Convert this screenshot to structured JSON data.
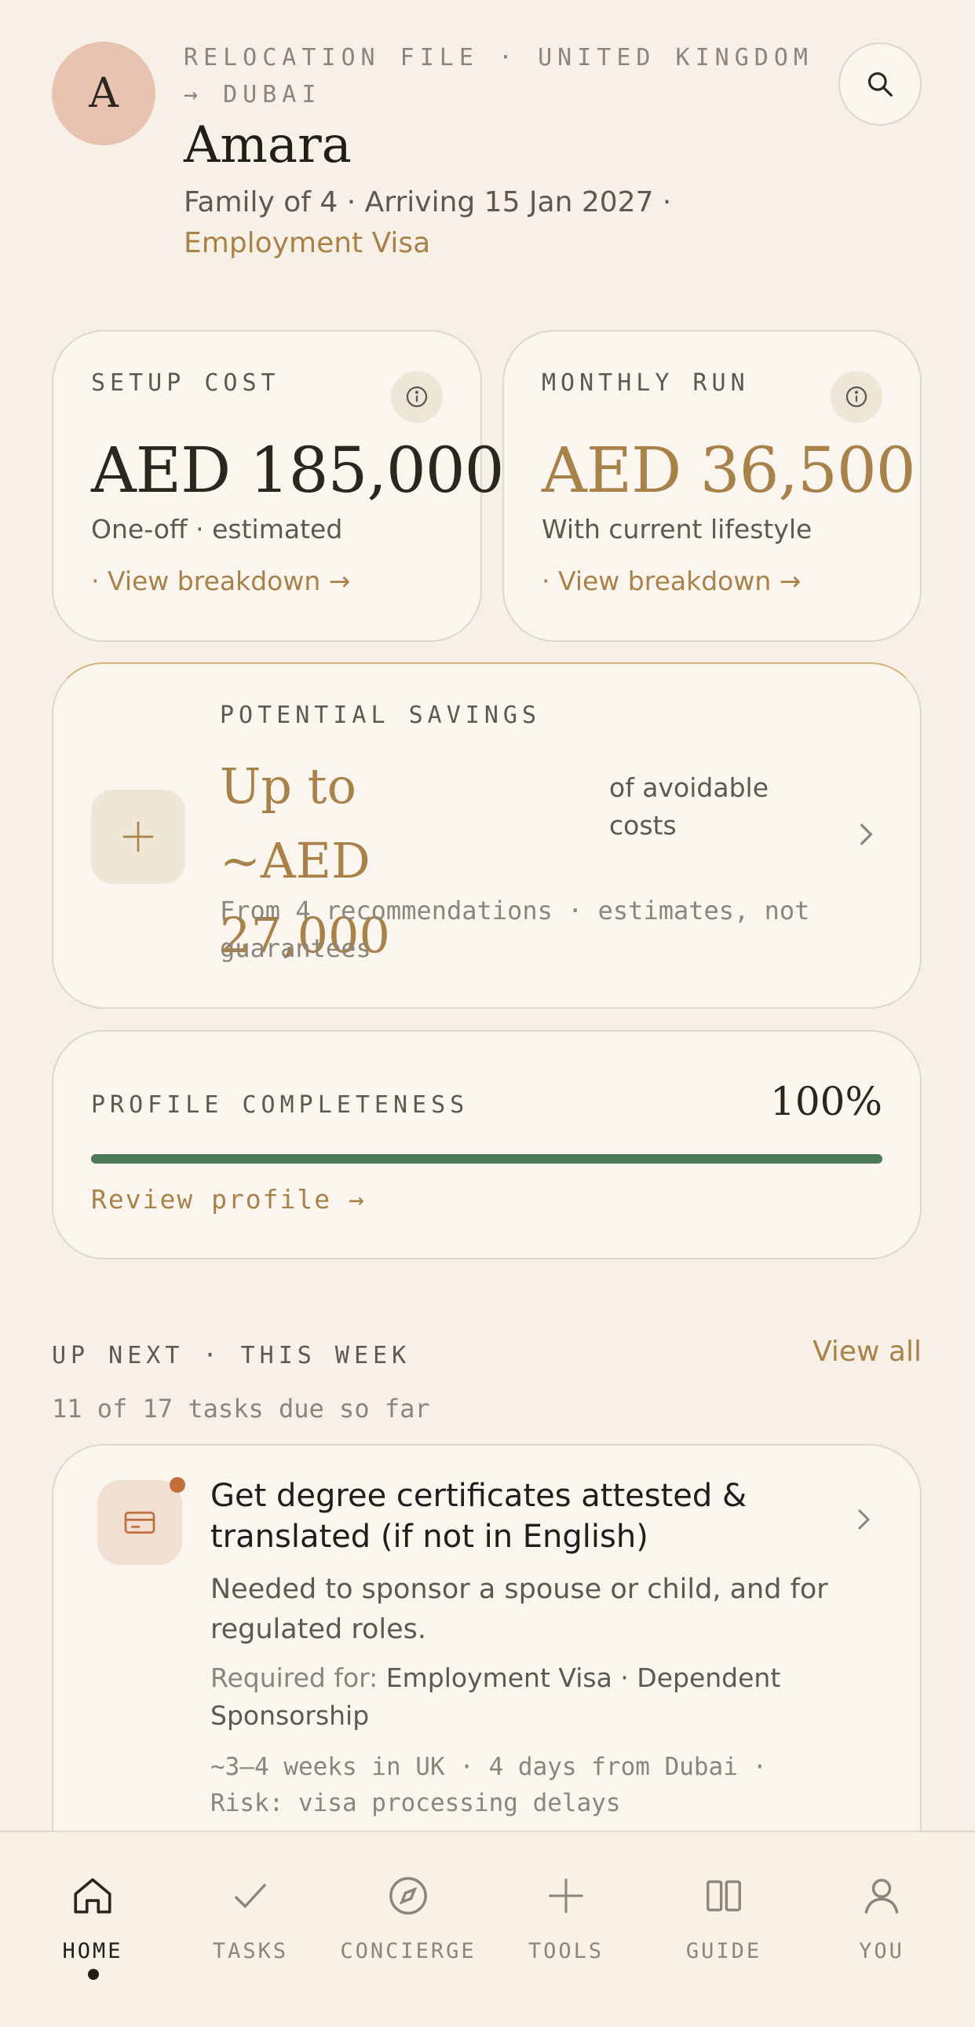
{
  "header": {
    "avatar_initial": "A",
    "file_label": "RELOCATION FILE · UNITED KINGDOM → DUBAI",
    "name": "Amara",
    "subtitle_plain": "Family of 4 · Arriving 15 Jan 2027 ·",
    "subtitle_accent": "Employment Visa",
    "search_icon": "search-icon"
  },
  "setup_cost": {
    "label": "SETUP COST",
    "value": "AED 185,000",
    "note": "One-off · estimated",
    "link": "· View breakdown →",
    "icon": "info-icon"
  },
  "monthly_run": {
    "label": "MONTHLY RUN",
    "value": "AED 36,500",
    "note": "With current lifestyle",
    "link": "· View breakdown →",
    "icon": "info-icon"
  },
  "savings": {
    "label": "POTENTIAL SAVINGS",
    "value_line1": "Up to",
    "value_line2": "~AED 27,000",
    "of_text": "of avoidable costs",
    "note": "From 4 recommendations · estimates, not guarantees",
    "icon": "sparkle-icon"
  },
  "profile": {
    "label": "PROFILE COMPLETENESS",
    "value": "100%",
    "progress": 1.0,
    "link": "Review profile →"
  },
  "up_next": {
    "label": "UP NEXT · THIS WEEK",
    "view_all": "View all",
    "tasks_due": "11 of 17 tasks due so far"
  },
  "task": {
    "title": "Get degree certificates attested & translated (if not in English)",
    "description": "Needed to sponsor a spouse or child, and for regulated roles.",
    "required_key": "Required for:",
    "required_value": "Employment Visa · Dependent Sponsorship",
    "eta": "~3–4 weeks in UK · 4 days from Dubai · Risk: visa processing delays",
    "icon": "document-card-icon"
  },
  "ghost_text": "English)",
  "nav": {
    "tabs": [
      {
        "label": "HOME",
        "icon": "home-icon",
        "active": true
      },
      {
        "label": "TASKS",
        "icon": "check-icon"
      },
      {
        "label": "CONCIERGE",
        "icon": "compass-icon"
      },
      {
        "label": "TOOLS",
        "icon": "sparkle-icon"
      },
      {
        "label": "GUIDE",
        "icon": "book-icon"
      },
      {
        "label": "YOU",
        "icon": "person-icon"
      }
    ]
  },
  "colors": {
    "background": "#f7f0e6",
    "accent": "#a88248",
    "progress": "#4c7a58",
    "avatar": "#e8c4b0"
  }
}
